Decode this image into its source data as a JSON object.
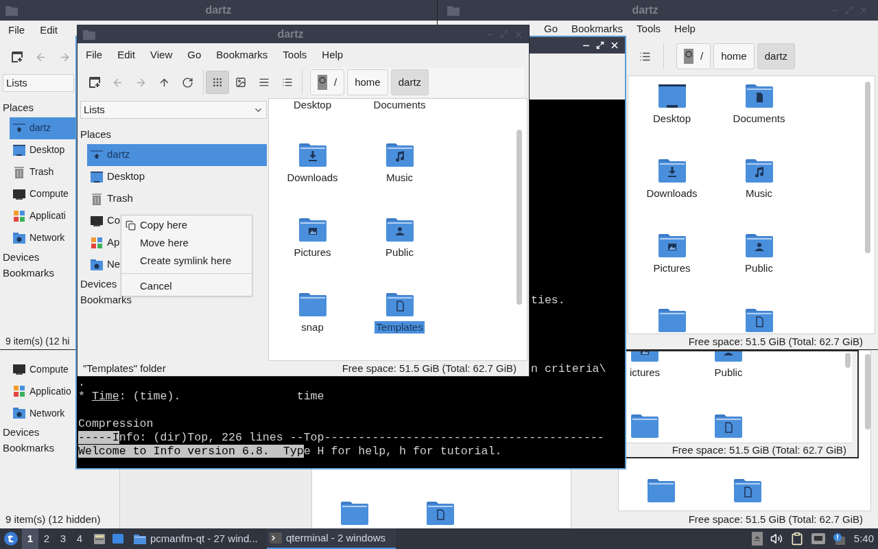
{
  "window_top_left": {
    "title": "dartz",
    "menu": [
      "File",
      "Edit"
    ],
    "combo": "Lists",
    "places_heading": "Places",
    "places": [
      {
        "label": "dartz",
        "kind": "home",
        "selected": true
      },
      {
        "label": "Desktop",
        "kind": "desktop",
        "selected": false
      },
      {
        "label": "Trash",
        "kind": "trash",
        "selected": false
      },
      {
        "label": "Compute",
        "kind": "computer",
        "selected": false
      },
      {
        "label": "Applicati",
        "kind": "apps",
        "selected": false
      },
      {
        "label": "Network",
        "kind": "network",
        "selected": false
      }
    ],
    "sections": [
      "Devices",
      "Bookmarks"
    ],
    "status": "9 item(s) (12 hi"
  },
  "window_top_right": {
    "title": "dartz",
    "menu": [
      "Go",
      "Bookmarks",
      "Tools",
      "Help"
    ],
    "breadcrumb": [
      {
        "label": "/",
        "kind": "root",
        "selected": false
      },
      {
        "label": "home",
        "kind": "folder",
        "selected": false
      },
      {
        "label": "dartz",
        "kind": "folder",
        "selected": true
      }
    ],
    "items": [
      {
        "label": "Desktop",
        "kind": "desktop"
      },
      {
        "label": "Documents",
        "kind": "document"
      },
      {
        "label": "Downloads",
        "kind": "download"
      },
      {
        "label": "Music",
        "kind": "music"
      },
      {
        "label": "Pictures",
        "kind": "picture"
      },
      {
        "label": "Public",
        "kind": "public"
      },
      {
        "kind": "plain"
      },
      {
        "kind": "template"
      }
    ],
    "status": "Free space: 51.5 GiB (Total: 62.7 GiB)"
  },
  "window_bottom_left": {
    "places": [
      {
        "label": "Compute",
        "kind": "computer",
        "selected": false
      },
      {
        "label": "Applicatio",
        "kind": "apps",
        "selected": false
      },
      {
        "label": "Network",
        "kind": "network",
        "selected": false
      }
    ],
    "sections": [
      "Devices",
      "Bookmarks"
    ],
    "status": "9 item(s) (12 hidden)",
    "items": [
      {
        "kind": "plain"
      },
      {
        "kind": "template"
      }
    ]
  },
  "window_bottom_right": {
    "items": [
      {
        "kind": "plain"
      },
      {
        "kind": "template"
      }
    ],
    "status": "Free space: 51.5 GiB (Total: 62.7 GiB)"
  },
  "window_middle_right": {
    "items": [
      {
        "label": "ictures",
        "kind": "picture"
      },
      {
        "label": "Public",
        "kind": "public"
      },
      {
        "kind": "plain"
      },
      {
        "kind": "template"
      }
    ],
    "status": "Free space: 51.5 GiB (Total: 62.7 GiB)"
  },
  "terminal": {
    "lines": [
      {
        "kind": "clipped",
        "segments": [
          {
            "text": "ties.",
            "kind": "plain"
          }
        ]
      },
      {
        "kind": "blank"
      },
      {
        "kind": "blank"
      },
      {
        "kind": "blank"
      },
      {
        "kind": "blank"
      },
      {
        "kind": "clipped",
        "segments": [
          {
            "text": "n criteria\\",
            "kind": "plain"
          }
        ]
      },
      {
        "kind": "text",
        "segments": [
          {
            "text": ".",
            "kind": "plain"
          }
        ]
      },
      {
        "kind": "text",
        "segments": [
          {
            "text": "* ",
            "kind": "plain"
          },
          {
            "text": "Time",
            "kind": "underline"
          },
          {
            "text": ": (time).                 time",
            "kind": "plain"
          }
        ]
      },
      {
        "kind": "blank"
      },
      {
        "kind": "text",
        "segments": [
          {
            "text": "Compression",
            "kind": "plain"
          }
        ]
      },
      {
        "kind": "text",
        "segments": [
          {
            "text": "-----I",
            "kind": "highlight"
          },
          {
            "text": "nfo: (dir)Top, 226 lines --Top-----------------------------------------",
            "kind": "plain"
          }
        ]
      },
      {
        "kind": "text",
        "segments": [
          {
            "text": "Welcome to Info version 6.8.  Typ",
            "kind": "highlight"
          },
          {
            "text": "e H for help, h for tutorial.",
            "kind": "plain"
          }
        ]
      }
    ]
  },
  "file_manager": {
    "title": "dartz",
    "menu": [
      "File",
      "Edit",
      "View",
      "Go",
      "Bookmarks",
      "Tools",
      "Help"
    ],
    "view_modes": [
      {
        "kind": "icons",
        "selected": true
      },
      {
        "kind": "thumbnails",
        "selected": false
      },
      {
        "kind": "compact",
        "selected": false
      },
      {
        "kind": "details",
        "selected": false
      }
    ],
    "breadcrumb": [
      {
        "label": "/",
        "kind": "root",
        "selected": false
      },
      {
        "label": "home",
        "kind": "folder",
        "selected": false
      },
      {
        "label": "dartz",
        "kind": "folder",
        "selected": true
      }
    ],
    "combo": "Lists",
    "places_heading": "Places",
    "places": [
      {
        "label": "dartz",
        "kind": "home",
        "selected": true
      },
      {
        "label": "Desktop",
        "kind": "desktop",
        "selected": false
      },
      {
        "label": "Trash",
        "kind": "trash",
        "selected": false
      },
      {
        "label": "Co",
        "kind": "computer",
        "selected": false
      },
      {
        "label": "Ap",
        "kind": "apps",
        "selected": false
      },
      {
        "label": "Ne",
        "kind": "network",
        "selected": false
      }
    ],
    "sections": [
      "Devices",
      "Bookmarks"
    ],
    "items": [
      {
        "label": "Desktop",
        "kind": "label_only",
        "selected": false
      },
      {
        "label": "Documents",
        "kind": "label_only",
        "selected": false
      },
      {
        "label": "Downloads",
        "kind": "download",
        "selected": false
      },
      {
        "label": "Music",
        "kind": "music",
        "selected": false
      },
      {
        "label": "Pictures",
        "kind": "picture",
        "selected": false
      },
      {
        "label": "Public",
        "kind": "public",
        "selected": false
      },
      {
        "label": "snap",
        "kind": "plain",
        "selected": false
      },
      {
        "label": "Templates",
        "kind": "template",
        "selected": true
      }
    ],
    "status_left": "\"Templates\" folder",
    "status_right": "Free space: 51.5 GiB (Total: 62.7 GiB)",
    "context_menu": [
      {
        "label": "Copy here",
        "kind": "copy"
      },
      {
        "label": "Move here",
        "kind": "item"
      },
      {
        "label": "Create symlink here",
        "kind": "item"
      },
      {
        "kind": "separator"
      },
      {
        "label": "Cancel",
        "kind": "item"
      }
    ]
  },
  "taskbar": {
    "workspaces": [
      {
        "label": "1",
        "selected": true
      },
      {
        "label": "2",
        "selected": false
      },
      {
        "label": "3",
        "selected": false
      },
      {
        "label": "4",
        "selected": false
      }
    ],
    "tasks": [
      {
        "label": "pcmanfm-qt - 27 wind...",
        "kind": "folder",
        "selected": false
      },
      {
        "label": "qterminal - 2 windows",
        "kind": "terminal",
        "selected": true
      }
    ],
    "clock": "5:40"
  }
}
